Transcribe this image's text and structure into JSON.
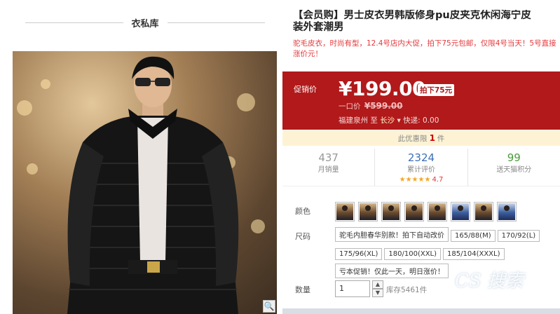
{
  "shop": {
    "name": "衣私库"
  },
  "product": {
    "title_line1": "【会员购】男士皮衣男韩版修身pu皮夹克休闲海宁皮",
    "title_line2": "装外套潮男",
    "subtitle": "驼毛皮衣，时尚有型，12.4号店内大促，拍下75元包邮，仅限4号当天！5号直接涨价元！"
  },
  "price": {
    "label": "促销价",
    "value": "¥199.00",
    "discount_badge": "拍下75元",
    "orig_label": "一口价",
    "orig_value": "¥599.00",
    "ship_from": "福建泉州",
    "ship_to_word": "至",
    "ship_to": "长沙",
    "express": "快递: 0.00"
  },
  "limit": {
    "prefix": "此优惠限",
    "count": "1",
    "suffix": "件"
  },
  "stats": [
    {
      "num": "437",
      "label": "月销量",
      "color": "#999999"
    },
    {
      "num": "2324",
      "label": "累计评价",
      "color": "#3b6fb6",
      "stars": "★★★★★",
      "score": "4.7"
    },
    {
      "num": "99",
      "label": "送天猫积分",
      "color": "#4a9a3a"
    }
  ],
  "color_label": "颜色",
  "size_label": "尺码",
  "sizes": [
    "驼毛内胆春华别款！拍下自动改价",
    "165/88(M)",
    "170/92(L)",
    "175/96(XL)",
    "180/100(XXL)",
    "185/104(XXXL)",
    "亏本促销！仅此一天，明日涨价！"
  ],
  "quantity": {
    "label": "数量",
    "value": "1",
    "stock": "库存5461件"
  },
  "watermark": "CS 搜索",
  "icons": {
    "zoom": "zoom-icon",
    "up": "arrow-up-icon",
    "down": "arrow-down-icon"
  },
  "colors": {
    "price_bg": "#b1191a",
    "limit_bg": "#fdf3d4",
    "accent": "#e4393c"
  }
}
